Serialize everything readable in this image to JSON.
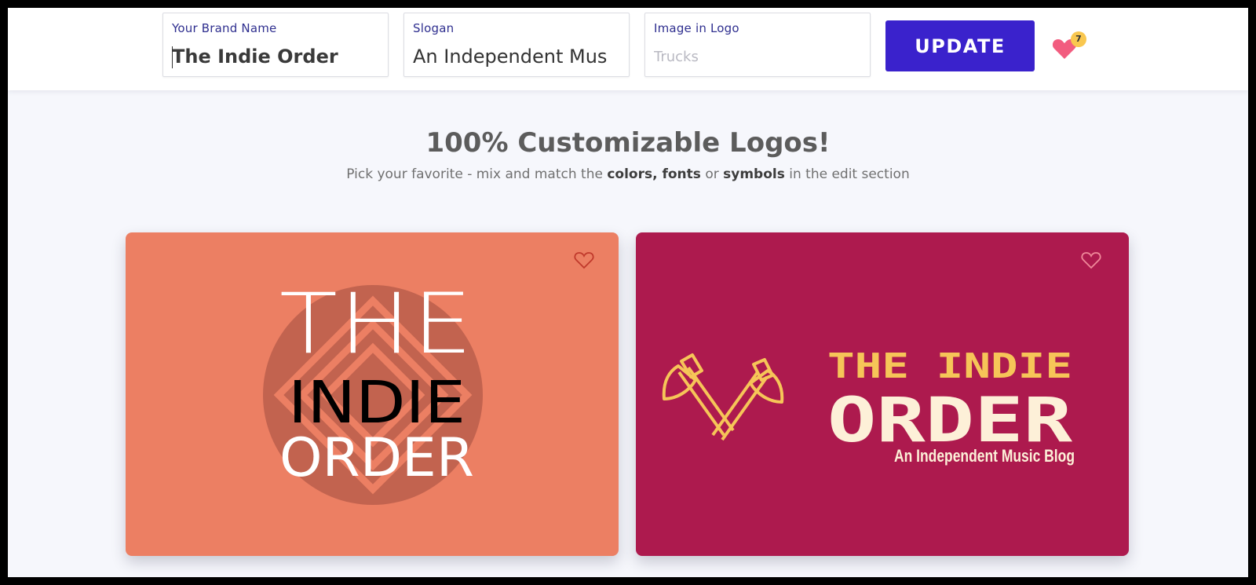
{
  "header": {
    "brand_label": "Your Brand Name",
    "brand_value": "The Indie Order",
    "slogan_label": "Slogan",
    "slogan_value": "An Independent Mus",
    "image_label": "Image in Logo",
    "image_placeholder": "Trucks",
    "update_label": "UPDATE",
    "favorites_count": "7"
  },
  "intro": {
    "headline": "100% Customizable Logos!",
    "sub_prefix": "Pick your favorite - mix and match the ",
    "sub_bold1": "colors, fonts",
    "sub_mid": " or ",
    "sub_bold2": "symbols",
    "sub_suffix": " in the edit section"
  },
  "cards": [
    {
      "background": "#ec7f63",
      "line1": "THE",
      "line2": "INDIE",
      "line3": "ORDER",
      "icon": "concentric-diamond-icon",
      "icon_color": "#c2634f"
    },
    {
      "background": "#ad1a4e",
      "line1": "THE INDIE",
      "line2": "ORDER",
      "slogan": "An Independent Music Blog",
      "icon": "crossed-axes-icon",
      "accent": "#f6c558",
      "cream": "#fdf0d8"
    }
  ]
}
